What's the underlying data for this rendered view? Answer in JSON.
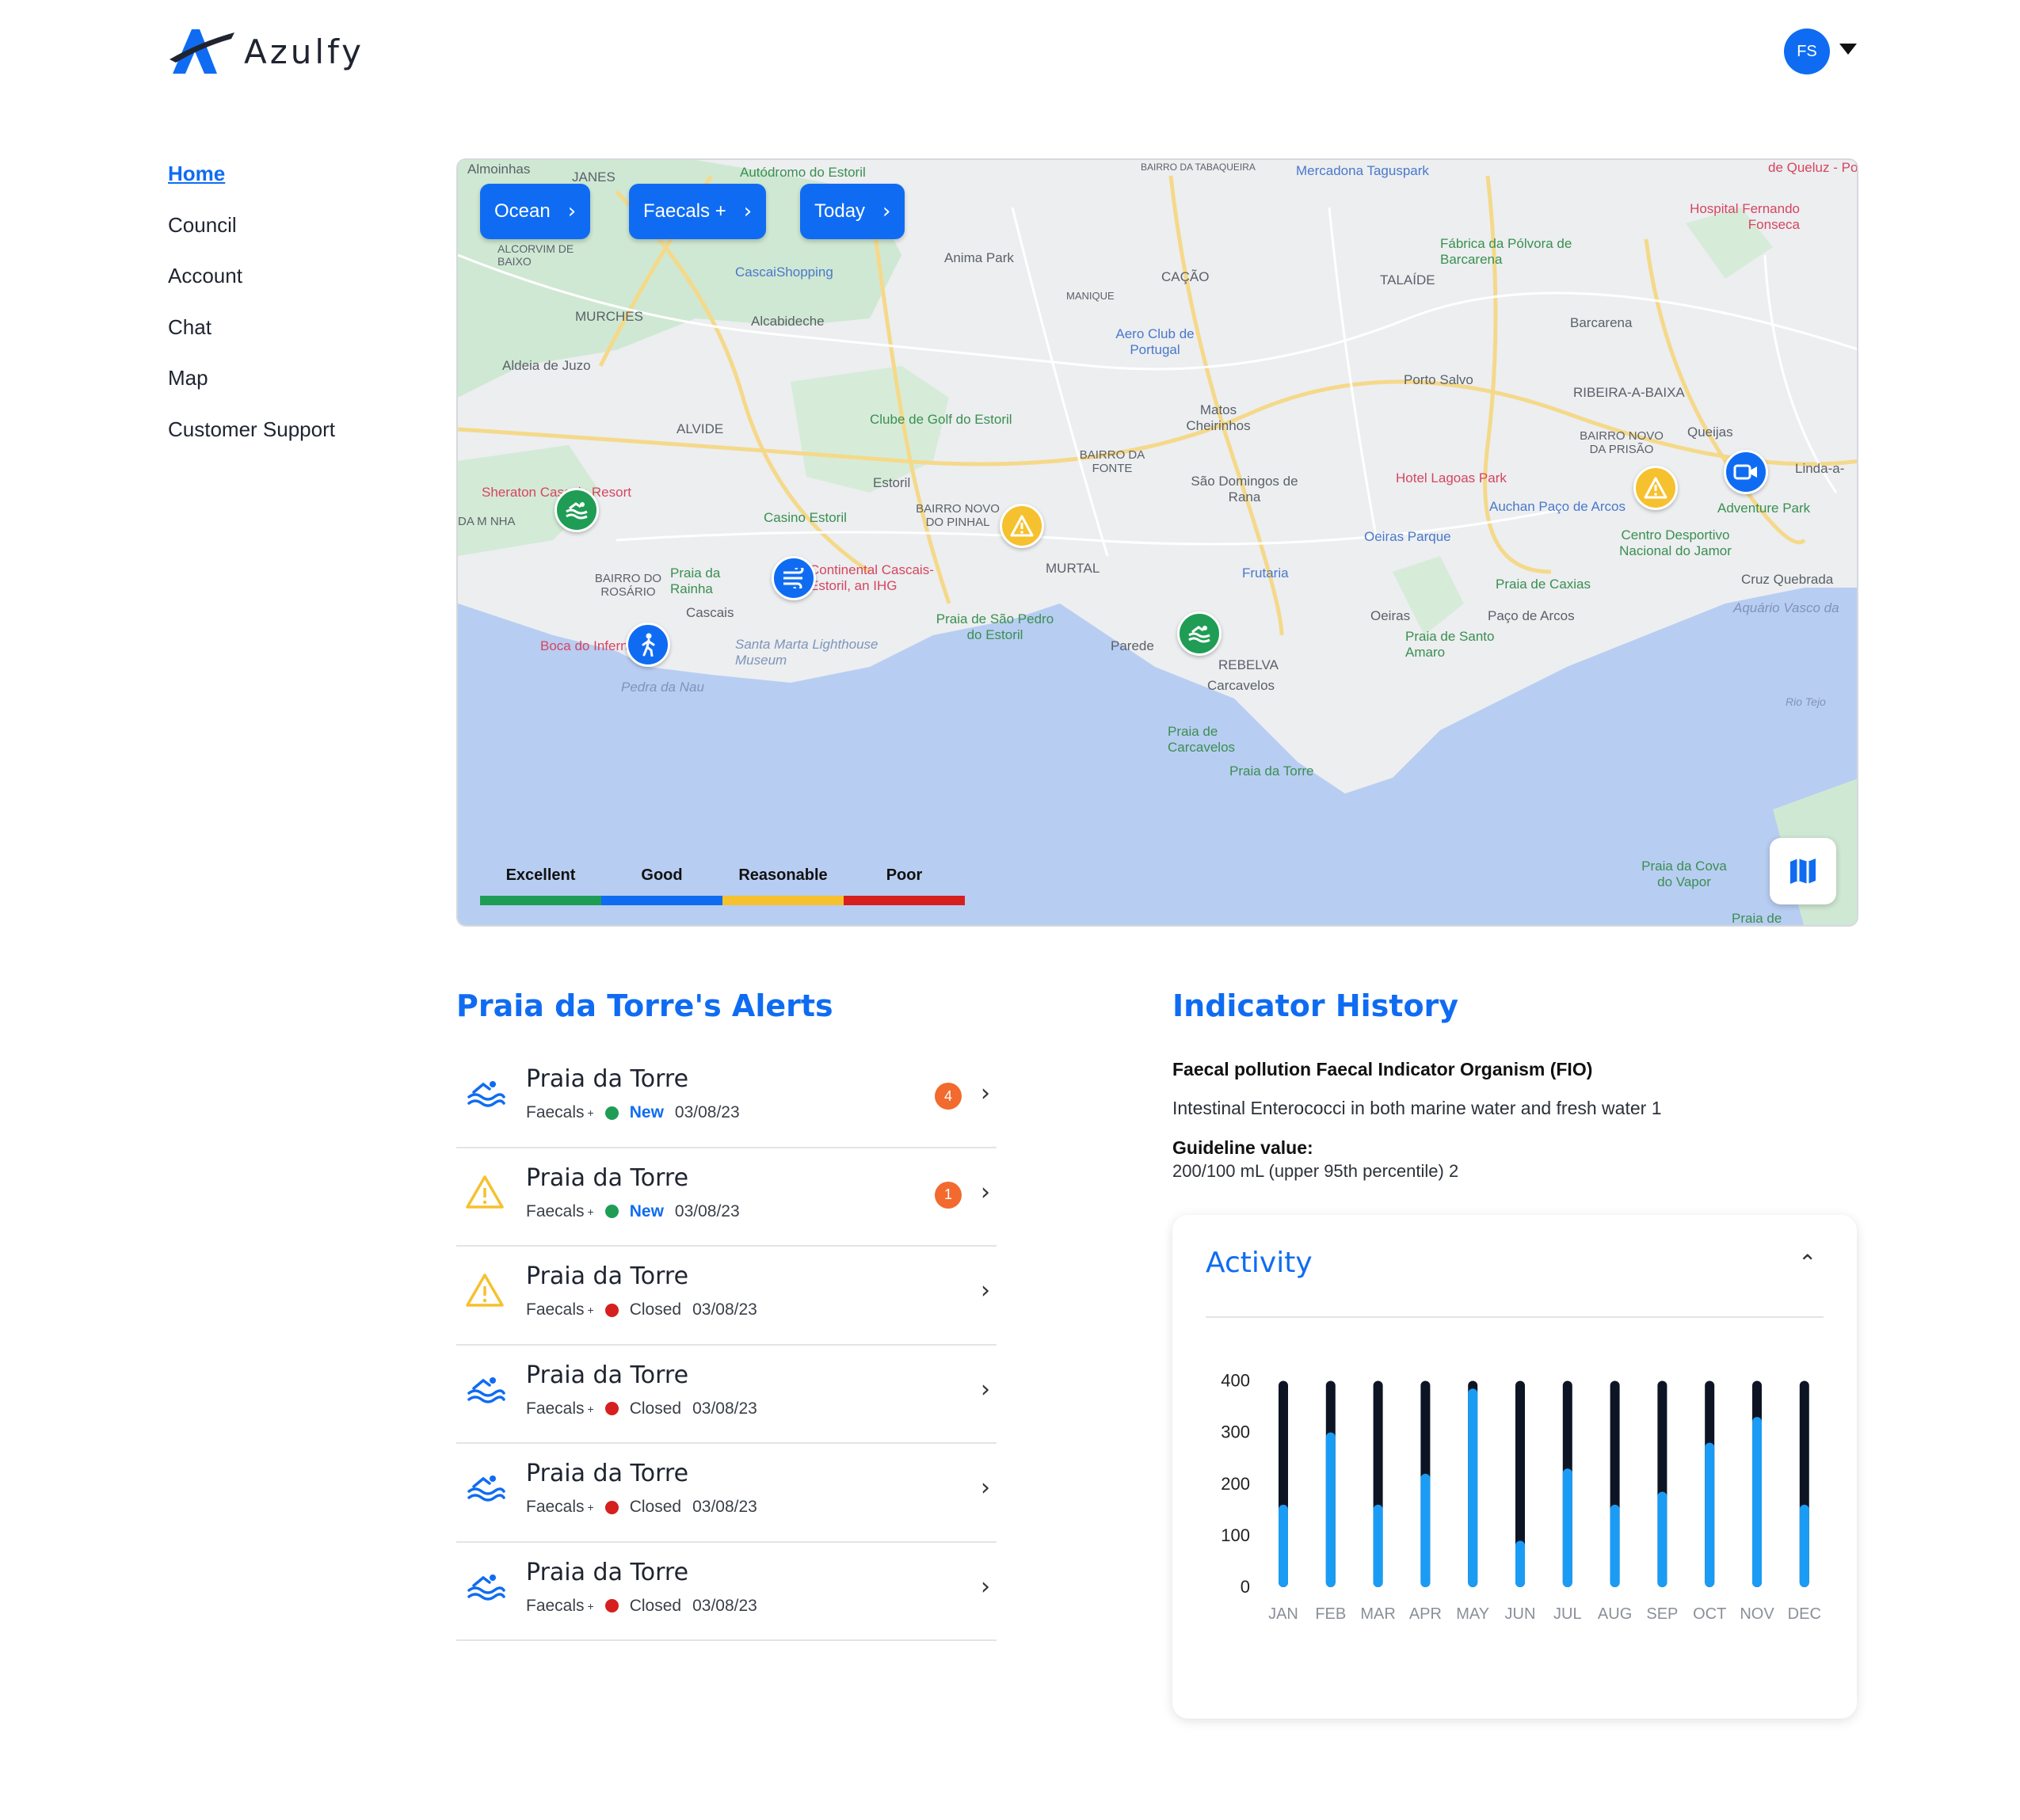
{
  "app": {
    "name": "Azulfy",
    "user_initials": "FS"
  },
  "nav": {
    "items": [
      {
        "label": "Home",
        "active": true
      },
      {
        "label": "Council",
        "active": false
      },
      {
        "label": "Account",
        "active": false
      },
      {
        "label": "Chat",
        "active": false
      },
      {
        "label": "Map",
        "active": false
      },
      {
        "label": "Customer Support",
        "active": false
      }
    ]
  },
  "map": {
    "filters": [
      {
        "label": "Ocean"
      },
      {
        "label": "Faecals +"
      },
      {
        "label": "Today"
      }
    ],
    "legend": [
      {
        "label": "Excellent",
        "color": "#1f9d55"
      },
      {
        "label": "Good",
        "color": "#0f6cf2"
      },
      {
        "label": "Reasonable",
        "color": "#f6c12f"
      },
      {
        "label": "Poor",
        "color": "#d61f1f"
      }
    ],
    "places": {
      "almoinhas": "Almoinhas",
      "janes": "JANES",
      "autodromo": "Autódromo do Estoril",
      "bairro_tabaqueira": "BAIRRO DA TABAQUEIRA",
      "mercadona": "Mercadona Taguspark",
      "queluz": "de Queluz - Po",
      "hospital": "Hospital Fernando Fonseca",
      "alcorvim": "ALCORVIM DE BAIXO",
      "cascaishopping": "CascaiShopping",
      "anima_park": "Anima Park",
      "cacao": "CAÇÃO",
      "talaide": "TALAÍDE",
      "fabrica_polvora": "Fábrica da Pólvora de Barcarena",
      "murches": "MURCHES",
      "alcabideche": "Alcabideche",
      "manique": "MANIQUE",
      "aero_club": "Aero Club de Portugal",
      "barcarena": "Barcarena",
      "aldeia_juzo": "Aldeia de Juzo",
      "alvide": "ALVIDE",
      "clube_golf": "Clube de Golf do Estoril",
      "matos_cheirinhos": "Matos Cheirinhos",
      "porto_salvo": "Porto Salvo",
      "ribeira_baixa": "RIBEIRA-A-BAIXA",
      "bairro_fonte": "BAIRRO DA FONTE",
      "sao_domingos": "São Domingos de Rana",
      "bairro_prisao": "BAIRRO NOVO DA PRISÃO",
      "queijas": "Queijas",
      "linda_a_velha": "Linda-a-",
      "hotel_lagoas": "Hotel Lagoas Park",
      "estoril": "Estoril",
      "sheraton": "Sheraton Cascais Resort",
      "bairro_pinhal": "BAIRRO NOVO DO PINHAL",
      "auchan": "Auchan Paço de Arcos",
      "adventure_park": "Adventure Park",
      "da_m_nha": "DA M NHA",
      "casino_estoril": "Casino Estoril",
      "oeiras_parque": "Oeiras Parque",
      "centro_jamor": "Centro Desportivo Nacional do Jamor",
      "bairro_rosario": "BAIRRO DO ROSÁRIO",
      "praia_rainha": "Praia da Rainha",
      "continental": "Continental Cascais-Estoril, an IHG",
      "murtal": "MURTAL",
      "frutaria": "Frutaria",
      "praia_caxias": "Praia de Caxias",
      "cruz_quebrada": "Cruz Quebrada",
      "cascais": "Cascais",
      "praia_sao_pedro": "Praia de São Pedro do Estoril",
      "oeiras": "Oeiras",
      "paco_arcos": "Paço de Arcos",
      "aquario": "Aquário Vasco da",
      "parede": "Parede",
      "boca_inferno": "Boca do Inferno",
      "santa_marta": "Santa Marta Lighthouse Museum",
      "rebelva": "REBELVA",
      "praia_santo_amaro": "Praia de Santo Amaro",
      "carcavelos": "Carcavelos",
      "pedra_nau": "Pedra da Nau",
      "rio_tejo": "Rio Tejo",
      "praia_carcavelos": "Praia de Carcavelos",
      "praia_torre": "Praia da Torre",
      "praia_cova": "Praia da Cova do Vapor",
      "praia_de": "Praia de"
    }
  },
  "alerts": {
    "title": "Praia da Torre's Alerts",
    "items": [
      {
        "title": "Praia da Torre",
        "icon": "swimming-icon",
        "type": "Faecals",
        "type_sup": "+",
        "status": "New",
        "status_color": "#1f9d55",
        "date": "03/08/23",
        "badge": "4"
      },
      {
        "title": "Praia da Torre",
        "icon": "warning-icon",
        "type": "Faecals",
        "type_sup": "+",
        "status": "New",
        "status_color": "#1f9d55",
        "date": "03/08/23",
        "badge": "1"
      },
      {
        "title": "Praia da Torre",
        "icon": "warning-icon",
        "type": "Faecals",
        "type_sup": "+",
        "status": "Closed",
        "status_color": "#d61f1f",
        "date": "03/08/23",
        "badge": ""
      },
      {
        "title": "Praia da Torre",
        "icon": "swimming-icon",
        "type": "Faecals",
        "type_sup": "+",
        "status": "Closed",
        "status_color": "#d61f1f",
        "date": "03/08/23",
        "badge": ""
      },
      {
        "title": "Praia da Torre",
        "icon": "swimming-icon",
        "type": "Faecals",
        "type_sup": "+",
        "status": "Closed",
        "status_color": "#d61f1f",
        "date": "03/08/23",
        "badge": ""
      },
      {
        "title": "Praia da Torre",
        "icon": "swimming-icon",
        "type": "Faecals",
        "type_sup": "+",
        "status": "Closed",
        "status_color": "#d61f1f",
        "date": "03/08/23",
        "badge": ""
      }
    ]
  },
  "indicator": {
    "title": "Indicator History",
    "heading": "Faecal pollution Faecal Indicator Organism (FIO)",
    "description": "Intestinal Enterococci in both marine water and fresh water 1",
    "guideline_label": "Guideline value:",
    "guideline_value": "200/100 mL (upper 95th percentile) 2"
  },
  "activity": {
    "title": "Activity"
  },
  "chart_data": {
    "type": "bar",
    "categories": [
      "JAN",
      "FEB",
      "MAR",
      "APR",
      "MAY",
      "JUN",
      "JUL",
      "AUG",
      "SEP",
      "OCT",
      "NOV",
      "DEC"
    ],
    "values": [
      160,
      300,
      160,
      220,
      385,
      90,
      230,
      160,
      185,
      280,
      330,
      160
    ],
    "max_track": 400,
    "yticks": [
      0,
      100,
      200,
      300,
      400
    ],
    "ylim": [
      0,
      430
    ],
    "colors": {
      "bar": "#1a9cf5",
      "track": "#0d1424"
    }
  }
}
